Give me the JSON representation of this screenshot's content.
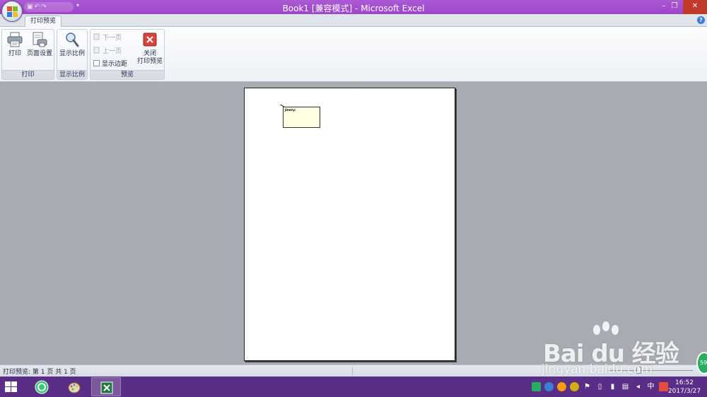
{
  "window": {
    "title": "Book1  [兼容模式] - Microsoft Excel",
    "minimize": "–",
    "restore": "❐",
    "close": "✕"
  },
  "qat": {
    "save": "▣",
    "undo": "↶",
    "redo": "↷",
    "dropdown": "▾"
  },
  "tabs": [
    {
      "label": "打印预览",
      "active": true
    }
  ],
  "help": "?",
  "ribbon": {
    "print_group": {
      "label": "打印",
      "print_button": "打印",
      "page_setup_button": "页面设置"
    },
    "zoom_group": {
      "label": "显示比例",
      "zoom_button": "显示比例"
    },
    "preview_group": {
      "label": "预览",
      "next_page": "下一页",
      "prev_page": "上一页",
      "show_margins": "显示边距",
      "close_preview_line1": "关闭",
      "close_preview_line2": "打印预览"
    }
  },
  "page": {
    "comment_text": "Jimmy:"
  },
  "status": {
    "text": "打印预览: 第 1 页  共 1 页"
  },
  "taskbar": {
    "tray_ime": "中",
    "clock_time": "16:52",
    "clock_date": "2017/3/27"
  },
  "watermark": {
    "main": "Bai du 经验",
    "sub": "jingyan.baidu.com"
  },
  "badge": "59",
  "colors": {
    "titlebar": "#9b45c9",
    "taskbar": "#5a2d86",
    "workspace": "#a8acb2",
    "close_red": "#c0392b"
  }
}
